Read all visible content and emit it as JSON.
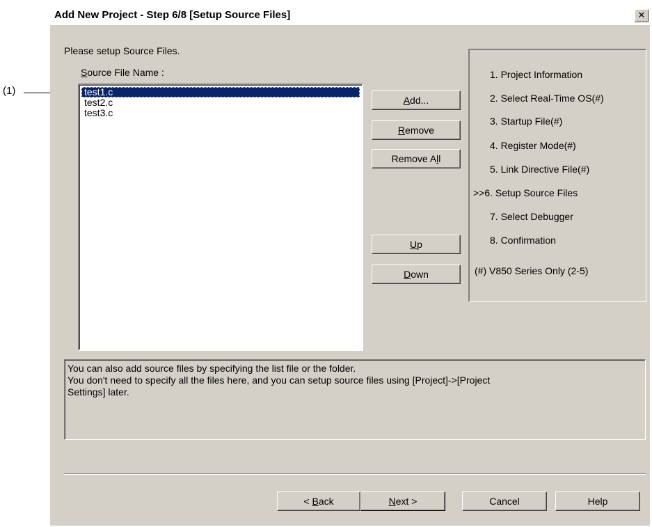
{
  "callout": {
    "label": "(1)"
  },
  "dialog": {
    "title": "Add New Project - Step 6/8 [Setup Source Files]",
    "close_glyph": "✕",
    "instruction": "Please setup Source Files.",
    "list_label_accel": "S",
    "list_label_rest": "ource File Name :",
    "files": [
      "test1.c",
      "test2.c",
      "test3.c"
    ],
    "selected_index": 0,
    "buttons": {
      "add_accel": "A",
      "add_rest": "dd...",
      "remove_accel": "R",
      "remove_rest": "emove",
      "remove_all_pre": "Remove A",
      "remove_all_accel": "l",
      "remove_all_post": "l",
      "up_accel": "U",
      "up_rest": "p",
      "down_accel": "D",
      "down_rest": "own"
    },
    "steps": [
      "1. Project Information",
      "2. Select Real-Time OS(#)",
      "3. Startup File(#)",
      "4. Register Mode(#)",
      "5. Link Directive File(#)",
      ">>6. Setup Source Files",
      "7. Select Debugger",
      "8. Confirmation"
    ],
    "steps_note": "(#) V850 Series Only (2-5)",
    "info_lines": [
      "You can also add source files by specifying the list file or the folder.",
      "You don't need to specify all the files here, and you can setup source files using [Project]->[Project",
      "Settings] later."
    ],
    "footer": {
      "back_pre": "< ",
      "back_accel": "B",
      "back_rest": "ack",
      "next_accel": "N",
      "next_rest": "ext >",
      "cancel": "Cancel",
      "help": "Help"
    }
  }
}
